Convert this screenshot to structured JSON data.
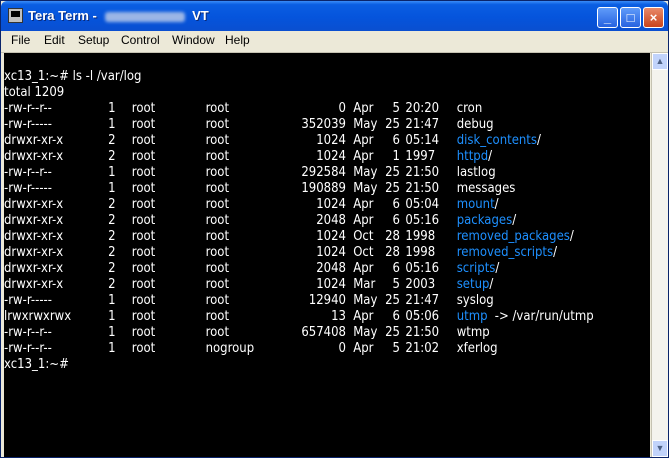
{
  "window": {
    "title_prefix": "Tera Term -",
    "title_suffix": "VT",
    "buttons": {
      "minimize": "_",
      "maximize": "□",
      "close": "×"
    }
  },
  "menu": [
    "File",
    "Edit",
    "Setup",
    "Control",
    "Window",
    "Help"
  ],
  "terminal": {
    "command": "xc13_1:~# ls -l /var/log",
    "total": "total 1209",
    "prompt": "xc13_1:~#",
    "rows": [
      {
        "perm": "-rw-r--r--",
        "links": "1",
        "owner": "root",
        "group": "root",
        "size": "0",
        "month": "Apr",
        "day": "5",
        "time": "20:20",
        "name": "cron",
        "dir": false
      },
      {
        "perm": "-rw-r-----",
        "links": "1",
        "owner": "root",
        "group": "root",
        "size": "352039",
        "month": "May",
        "day": "25",
        "time": "21:47",
        "name": "debug",
        "dir": false
      },
      {
        "perm": "drwxr-xr-x",
        "links": "2",
        "owner": "root",
        "group": "root",
        "size": "1024",
        "month": "Apr",
        "day": "6",
        "time": "05:14",
        "name": "disk_contents",
        "dir": true
      },
      {
        "perm": "drwxr-xr-x",
        "links": "2",
        "owner": "root",
        "group": "root",
        "size": "1024",
        "month": "Apr",
        "day": "1",
        "time": "1997",
        "name": "httpd",
        "dir": true
      },
      {
        "perm": "-rw-r--r--",
        "links": "1",
        "owner": "root",
        "group": "root",
        "size": "292584",
        "month": "May",
        "day": "25",
        "time": "21:50",
        "name": "lastlog",
        "dir": false
      },
      {
        "perm": "-rw-r-----",
        "links": "1",
        "owner": "root",
        "group": "root",
        "size": "190889",
        "month": "May",
        "day": "25",
        "time": "21:50",
        "name": "messages",
        "dir": false
      },
      {
        "perm": "drwxr-xr-x",
        "links": "2",
        "owner": "root",
        "group": "root",
        "size": "1024",
        "month": "Apr",
        "day": "6",
        "time": "05:04",
        "name": "mount",
        "dir": true
      },
      {
        "perm": "drwxr-xr-x",
        "links": "2",
        "owner": "root",
        "group": "root",
        "size": "2048",
        "month": "Apr",
        "day": "6",
        "time": "05:16",
        "name": "packages",
        "dir": true
      },
      {
        "perm": "drwxr-xr-x",
        "links": "2",
        "owner": "root",
        "group": "root",
        "size": "1024",
        "month": "Oct",
        "day": "28",
        "time": "1998",
        "name": "removed_packages",
        "dir": true
      },
      {
        "perm": "drwxr-xr-x",
        "links": "2",
        "owner": "root",
        "group": "root",
        "size": "1024",
        "month": "Oct",
        "day": "28",
        "time": "1998",
        "name": "removed_scripts",
        "dir": true
      },
      {
        "perm": "drwxr-xr-x",
        "links": "2",
        "owner": "root",
        "group": "root",
        "size": "2048",
        "month": "Apr",
        "day": "6",
        "time": "05:16",
        "name": "scripts",
        "dir": true
      },
      {
        "perm": "drwxr-xr-x",
        "links": "2",
        "owner": "root",
        "group": "root",
        "size": "1024",
        "month": "Mar",
        "day": "5",
        "time": "2003",
        "name": "setup",
        "dir": true
      },
      {
        "perm": "-rw-r-----",
        "links": "1",
        "owner": "root",
        "group": "root",
        "size": "12940",
        "month": "May",
        "day": "25",
        "time": "21:47",
        "name": "syslog",
        "dir": false
      },
      {
        "perm": "lrwxrwxrwx",
        "links": "1",
        "owner": "root",
        "group": "root",
        "size": "13",
        "month": "Apr",
        "day": "6",
        "time": "05:06",
        "name": "utmp",
        "dir": true,
        "link": "-> /var/run/utmp"
      },
      {
        "perm": "-rw-r--r--",
        "links": "1",
        "owner": "root",
        "group": "root",
        "size": "657408",
        "month": "May",
        "day": "25",
        "time": "21:50",
        "name": "wtmp",
        "dir": false
      },
      {
        "perm": "-rw-r--r--",
        "links": "1",
        "owner": "root",
        "group": "nogroup",
        "size": "0",
        "month": "Apr",
        "day": "5",
        "time": "21:02",
        "name": "xferlog",
        "dir": false
      }
    ]
  }
}
